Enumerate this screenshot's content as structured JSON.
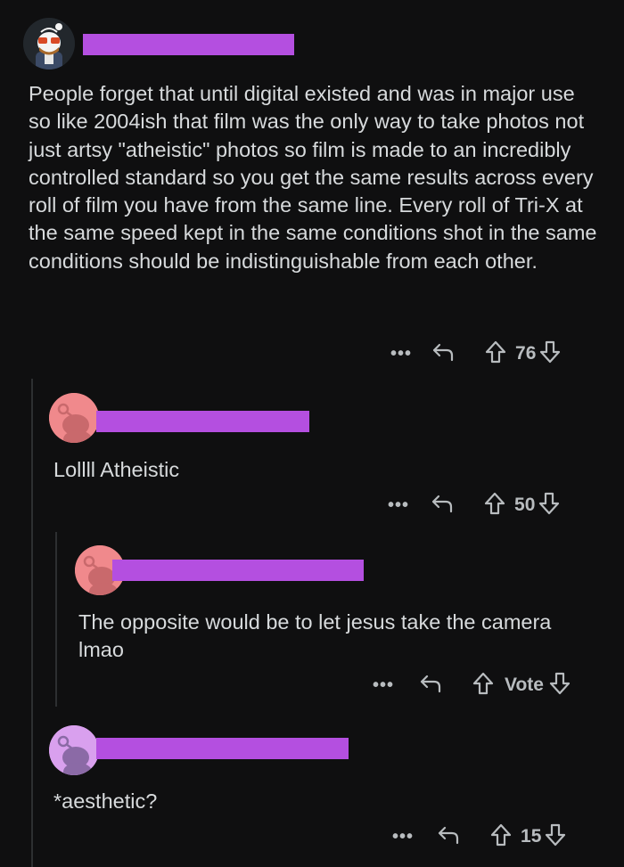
{
  "comments": [
    {
      "body": "People forget that until digital existed and was in major use so like 2004ish that film was the only way to take photos not just artsy \"atheistic\" photos so film is made to an incredibly controlled standard so you get the same results across every roll of film you have from the same line. Every roll of Tri-X at the same speed kept in the same conditions shot in the same conditions should be indistinguishable from each other.",
      "more": "•••",
      "score": "76"
    },
    {
      "body": "Lollll Atheistic",
      "more": "•••",
      "score": "50"
    },
    {
      "body": "The opposite would be to let jesus take the camera lmao",
      "more": "•••",
      "score": "Vote"
    },
    {
      "body": "*aesthetic?",
      "more": "•••",
      "score": "15"
    }
  ],
  "colors": {
    "background": "#0f0f10",
    "redaction": "#b44fe0",
    "text": "#d7dadc",
    "icon": "#b8bcbf"
  },
  "icons": [
    "user-avatar-icon",
    "more-options-icon",
    "reply-icon",
    "upvote-icon",
    "downvote-icon"
  ]
}
